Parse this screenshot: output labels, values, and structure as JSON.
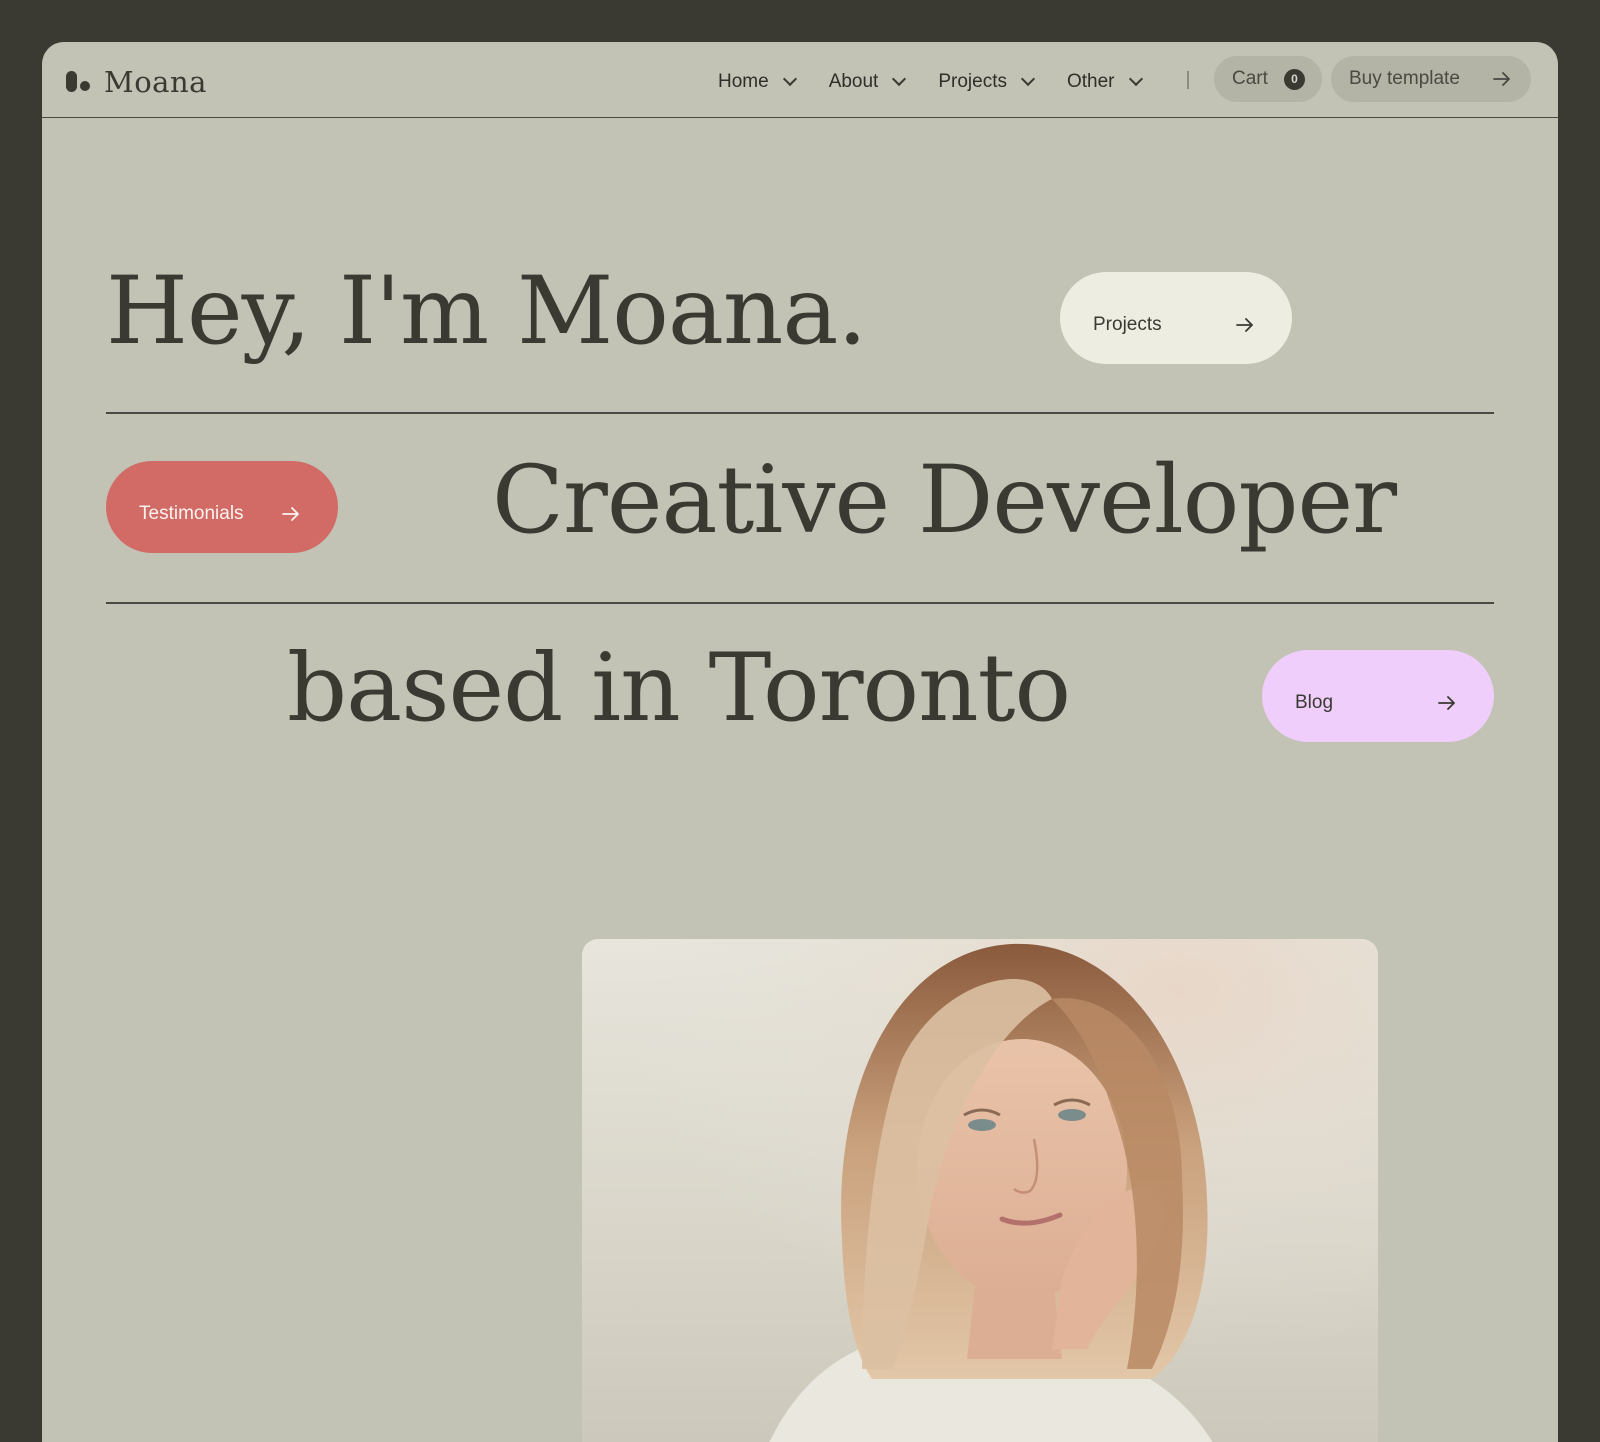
{
  "brand": {
    "name": "Moana"
  },
  "nav": {
    "items": [
      {
        "label": "Home"
      },
      {
        "label": "About"
      },
      {
        "label": "Projects"
      },
      {
        "label": "Other"
      }
    ],
    "cart_label": "Cart",
    "cart_count": "0",
    "buy_label": "Buy template"
  },
  "hero": {
    "line1": "Hey, I'm Moana.",
    "line2": "Creative Developer",
    "line3": "based in Toronto",
    "projects_button": "Projects",
    "testimonials_button": "Testimonials",
    "blog_button": "Blog"
  },
  "colors": {
    "background_outer": "#3a3a33",
    "page": "#c2c2b5",
    "text": "#3a3a33",
    "projects_pill": "#eeede2",
    "testimonials_pill": "#d26a66",
    "blog_pill": "#f0cefb"
  },
  "icons": {
    "nav_dropdown": "chevron-down-icon",
    "button_arrow": "arrow-right-icon"
  }
}
